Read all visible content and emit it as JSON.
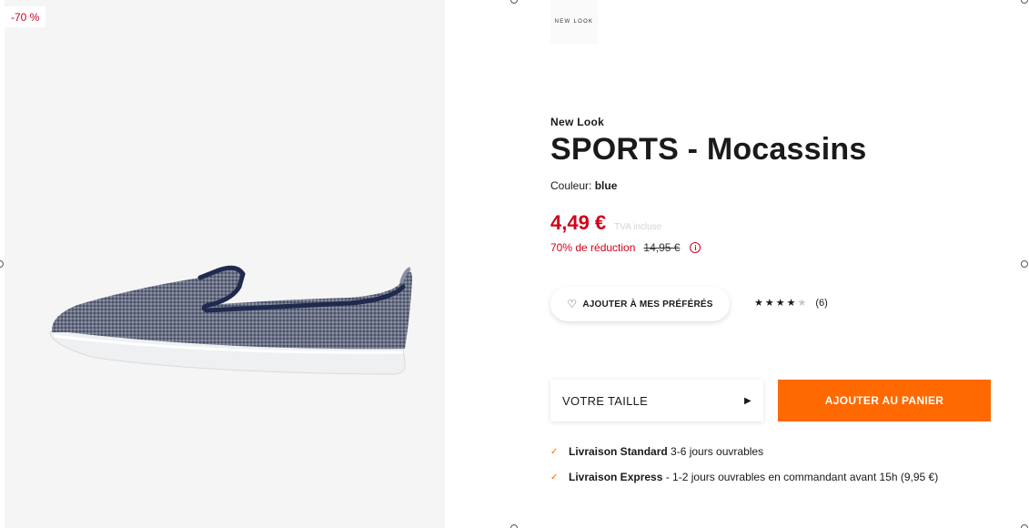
{
  "gallery": {
    "discount_flag": "-70 %",
    "image_alt": "SPORTS - Mocassins blue"
  },
  "brand": {
    "logo_text": "NEW LOOK",
    "name": "New Look"
  },
  "product": {
    "title": "SPORTS - Mocassins",
    "color_label": "Couleur:",
    "color_value": "blue"
  },
  "price": {
    "current": "4,49 €",
    "vat_note": "TVA incluse",
    "reduction": "70% de réduction",
    "original": "14,95 €",
    "info_icon": "info-icon"
  },
  "actions": {
    "wishlist_label": "AJOUTER À MES PRÉFÉRÉS",
    "size_label": "VOTRE TAILLE",
    "cart_label": "AJOUTER AU PANIER"
  },
  "rating": {
    "value": 4,
    "max": 5,
    "count": "(6)"
  },
  "delivery": [
    {
      "name": "Livraison Standard",
      "detail": " 3-6 jours ouvrables"
    },
    {
      "name": "Livraison Express",
      "detail": " - 1-2 jours ouvrables en commandant avant 15h (9,95 €)"
    }
  ],
  "colors": {
    "accent": "#ff6900",
    "sale": "#d0021b",
    "gallery_bg": "#f5f5f5"
  }
}
